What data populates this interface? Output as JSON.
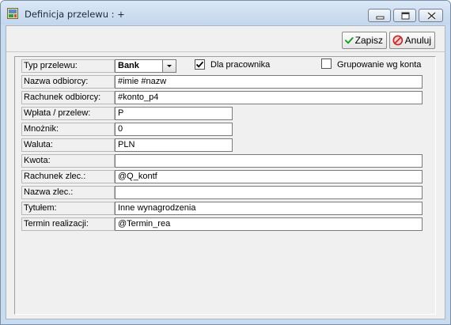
{
  "window": {
    "title": "Definicja przelewu : +"
  },
  "toolbar": {
    "save_label": "Zapisz",
    "cancel_label": "Anuluj"
  },
  "form": {
    "typ_label": "Typ przelewu:",
    "typ_value": "Bank",
    "dla_pracownika_label": "Dla pracownika",
    "dla_pracownika_checked": true,
    "grupowanie_label": "Grupowanie wg konta",
    "grupowanie_checked": false,
    "fields": [
      {
        "label": "Nazwa odbiorcy:",
        "value": "#imie #nazw"
      },
      {
        "label": "Rachunek odbiorcy:",
        "value": "#konto_p4"
      },
      {
        "label": "Wpłata / przelew:",
        "value": "P"
      },
      {
        "label": "Mnożnik:",
        "value": "0"
      },
      {
        "label": "Waluta:",
        "value": "PLN"
      },
      {
        "label": "Kwota:",
        "value": ""
      },
      {
        "label": "Rachunek zlec.:",
        "value": "@Q_kontf"
      },
      {
        "label": "Nazwa zlec.:",
        "value": ""
      },
      {
        "label": "Tytułem:",
        "value": "Inne wynagrodzenia"
      },
      {
        "label": "Termin realizacji:",
        "value": "@Termin_rea"
      }
    ]
  },
  "colors": {
    "save_check": "#1f9e2a",
    "cancel_icon": "#c8282a"
  }
}
